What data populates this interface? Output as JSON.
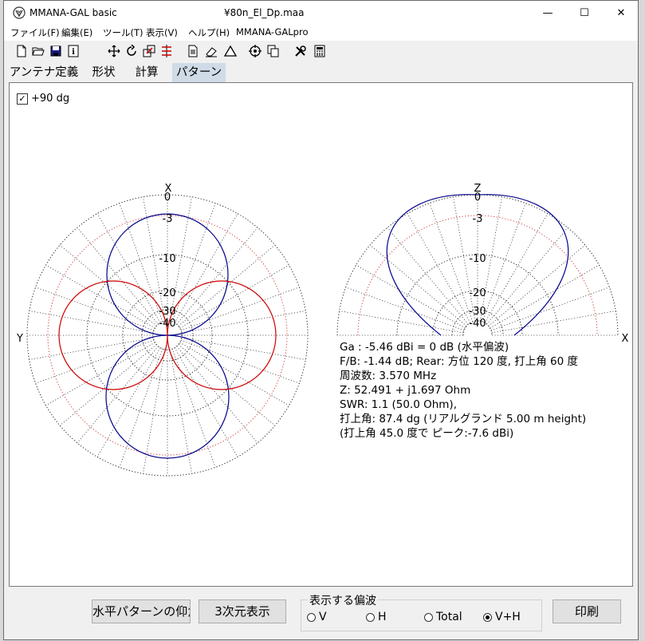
{
  "window": {
    "app_title": "MMANA-GAL basic",
    "file_name": "¥80n_El_Dp.maa",
    "minimize": "—",
    "maximize": "☐",
    "close": "✕"
  },
  "menu": [
    "ファイル(F)",
    "編集(E)",
    "ツール(T)",
    "表示(V)",
    "ヘルプ(H)",
    "MMANA-GALpro"
  ],
  "tabs": [
    {
      "label": "アンテナ定義"
    },
    {
      "label": "形状"
    },
    {
      "label": "計算"
    },
    {
      "label": "パターン",
      "active": true
    }
  ],
  "pattern": {
    "checkbox_label": "+90 dg",
    "checkbox_checked": true,
    "horizontal": {
      "top_label": "X",
      "left_label": "Y",
      "ring_labels": [
        "0",
        "-3",
        "-10",
        "-20",
        "-30",
        "-40"
      ]
    },
    "vertical": {
      "top_label": "Z",
      "right_label": "X",
      "ring_labels": [
        "0",
        "-3",
        "-10",
        "-20",
        "-30",
        "-40"
      ]
    },
    "colors": {
      "main_lobe": "#00008b",
      "second_lobe": "#cc0000"
    }
  },
  "info": {
    "gain": "Ga : -5.46 dBi = 0 dB (水平偏波)",
    "fb": "F/B: -1.44 dB; Rear: 方位 120 度,  打上角 60 度",
    "freq": "周波数: 3.570 MHz",
    "z": "Z: 52.491 + j1.697 Ohm",
    "swr": "SWR: 1.1 (50.0 Ohm),",
    "elev": "打上角: 87.4 dg (リアルグランド  5.00 m height)",
    "peak": "(打上角 45.0 度で ピーク:-7.6 dBi)"
  },
  "buttons": {
    "horizontal_pattern": "水平パターンの仰角",
    "view_3d": "3次元表示",
    "print": "印刷"
  },
  "polarization": {
    "title": "表示する偏波",
    "options": [
      {
        "label": "V",
        "selected": false
      },
      {
        "label": "H",
        "selected": false
      },
      {
        "label": "Total",
        "selected": false
      },
      {
        "label": "V+H",
        "selected": true
      }
    ]
  }
}
